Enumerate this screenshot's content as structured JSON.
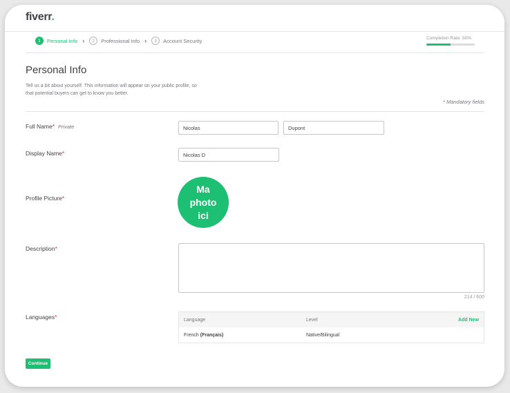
{
  "header": {
    "logo_text": "fiverr",
    "logo_dot": "."
  },
  "steps": [
    {
      "num": "1",
      "label": "Personal Info",
      "active": true
    },
    {
      "num": "2",
      "label": "Professional Info",
      "active": false
    },
    {
      "num": "3",
      "label": "Account Security",
      "active": false
    }
  ],
  "completion": {
    "label": "Completion Rate: 50%",
    "progress": 0.5
  },
  "page": {
    "title": "Personal Info",
    "intro": "Tell us a bit about yourself. This information will appear on your public profile, so that potential buyers can get to know you better.",
    "mandatory": "* Mandatory fields"
  },
  "fields": {
    "full_name": {
      "label": "Full Name",
      "req": "*",
      "private": "Private",
      "first": "Nicolas",
      "last": "Dupont"
    },
    "display_name": {
      "label": "Display Name",
      "req": "*",
      "value": "Nicolas D"
    },
    "profile_picture": {
      "label": "Profile Picture",
      "req": "*",
      "avatar_text": "Ma photo ici"
    },
    "description": {
      "label": "Description",
      "req": "*",
      "value": "",
      "counter": "214 / 600"
    },
    "languages": {
      "label": "Languages",
      "req": "*",
      "col_language": "Language",
      "col_level": "Level",
      "add_new": "Add New",
      "rows": [
        {
          "language": "French",
          "native": "(Français)",
          "level": "Native/Bilingual"
        }
      ]
    }
  },
  "actions": {
    "continue": "Continue"
  },
  "colors": {
    "accent": "#1dbf73",
    "required": "#e0245e"
  }
}
